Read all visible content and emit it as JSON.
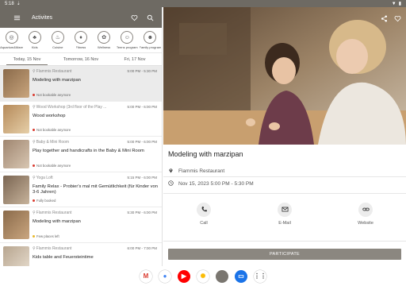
{
  "status_bar": {
    "time": "5:18"
  },
  "app_bar": {
    "title": "Activites"
  },
  "categories": [
    {
      "label": "Aquarium&Mare",
      "icon": "ball-icon",
      "glyph": "◎"
    },
    {
      "label": "Kids",
      "icon": "stroller-icon",
      "glyph": "♣"
    },
    {
      "label": "Cuisine",
      "icon": "cutlery-icon",
      "glyph": "♨"
    },
    {
      "label": "Fitness",
      "icon": "fitness-icon",
      "glyph": "♦"
    },
    {
      "label": "Wellness",
      "icon": "lotus-icon",
      "glyph": "✿"
    },
    {
      "label": "Teens program",
      "icon": "teen-icon",
      "glyph": "☺"
    },
    {
      "label": "Family program",
      "icon": "family-icon",
      "glyph": "☻"
    }
  ],
  "dates": [
    {
      "label": "Today, 15 Nov"
    },
    {
      "label": "Tomorrow, 16 Nov"
    },
    {
      "label": "Fri, 17 Nov"
    }
  ],
  "activities": [
    {
      "location": "Flammis Restaurant",
      "time": "5:00 PM - 5:30 PM",
      "name": "Modeling with marzipan",
      "status": "Not bookable anymore",
      "status_color": "#d93b30",
      "thumb_a": "#8a6a4a",
      "thumb_b": "#c9a57d"
    },
    {
      "location": "Wood Workshop (3rd floor of the Play ...",
      "time": "5:00 PM - 6:00 PM",
      "name": "Wood workshop",
      "status": "Not bookable anymore",
      "status_color": "#d93b30",
      "thumb_a": "#b58a5a",
      "thumb_b": "#e6cfa8"
    },
    {
      "location": "Baby & Mini Room",
      "time": "5:00 PM - 6:00 PM",
      "name": "Play together and handicrafts in the Baby & Mini Room",
      "status": "Not bookable anymore",
      "status_color": "#d93b30",
      "thumb_a": "#9f8670",
      "thumb_b": "#d8c6b2"
    },
    {
      "location": "Yoga Loft",
      "time": "5:15 PM - 6:00 PM",
      "name": "Family Relax - Probier's mal mit Gemütlichkeit (für Kinder von 3-6 Jahren)",
      "status": "Fully booked",
      "status_color": "#d93b30",
      "thumb_a": "#7a6552",
      "thumb_b": "#c7b39b"
    },
    {
      "location": "Flammis Restaurant",
      "time": "5:30 PM - 6:00 PM",
      "name": "Modeling with marzipan",
      "status": "Few places left",
      "status_color": "#e8b82a",
      "thumb_a": "#8a6a4a",
      "thumb_b": "#caa67f"
    },
    {
      "location": "Flammis Restaurant",
      "time": "6:00 PM - 7:00 PM",
      "name": "Kids table and Feuersteintime",
      "status": "",
      "status_color": "#e8b82a",
      "thumb_a": "#b7a58f",
      "thumb_b": "#e9dfd1"
    }
  ],
  "detail": {
    "title": "Modeling with marzipan",
    "location": "Flammis Restaurant",
    "datetime": "Nov 15, 2023 5:00 PM - 5:30 PM",
    "actions": [
      {
        "label": "Call",
        "icon": "phone-icon"
      },
      {
        "label": "E-Mail",
        "icon": "mail-icon"
      },
      {
        "label": "Website",
        "icon": "link-icon"
      }
    ],
    "participate_label": "PARTICIPATE"
  },
  "taskbar_apps": [
    {
      "name": "gmail-app-icon",
      "glyph": "M",
      "bg": "#ffffff",
      "fg": "#d93b30"
    },
    {
      "name": "chrome-app-icon",
      "glyph": "●",
      "bg": "#ffffff",
      "fg": "#4285f4"
    },
    {
      "name": "youtube-app-icon",
      "glyph": "▶",
      "bg": "#ff0000",
      "fg": "#ffffff"
    },
    {
      "name": "photos-app-icon",
      "glyph": "✺",
      "bg": "#ffffff",
      "fg": "#fbbc04"
    },
    {
      "name": "app-icon",
      "glyph": "",
      "bg": "#7a7670",
      "fg": "#ffffff"
    },
    {
      "name": "messages-app-icon",
      "glyph": "▭",
      "bg": "#1a73e8",
      "fg": "#ffffff"
    },
    {
      "name": "app-drawer-icon",
      "glyph": "⋮⋮",
      "bg": "#ffffff",
      "fg": "#333333"
    }
  ],
  "colors": {
    "appbar": "#6e6a63",
    "accent": "#8b8780"
  }
}
